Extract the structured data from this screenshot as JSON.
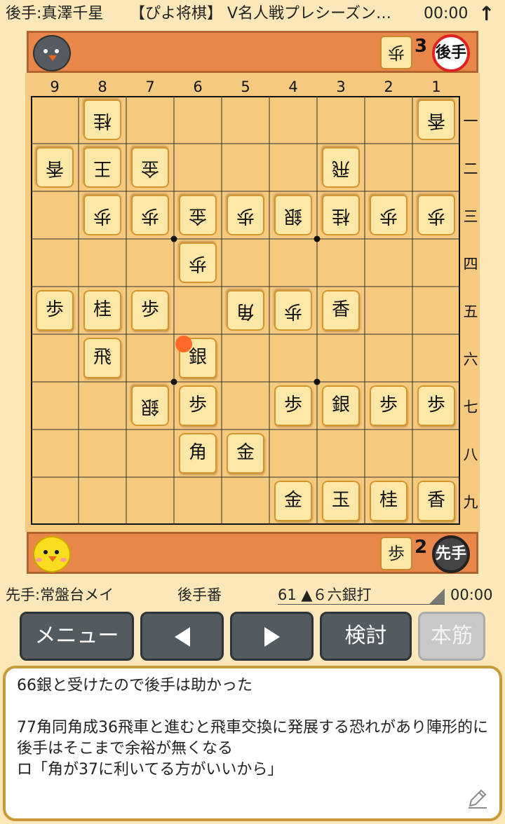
{
  "header": {
    "gote_player": "後手:真澤千星",
    "title": "【ぴよ将棋】 V名人戦プレシーズン…",
    "time": "00:00",
    "arrow": "↑"
  },
  "gote_stand": {
    "avatar": "gray-chick-icon",
    "hand_piece": "歩",
    "hand_count": "3",
    "side_label": "後手"
  },
  "sente_stand": {
    "avatar": "yellow-chick-icon",
    "hand_piece": "歩",
    "hand_count": "2",
    "side_label": "先手"
  },
  "board": {
    "files": [
      "9",
      "8",
      "7",
      "6",
      "5",
      "4",
      "3",
      "2",
      "1"
    ],
    "ranks": [
      "一",
      "二",
      "三",
      "四",
      "五",
      "六",
      "七",
      "八",
      "九"
    ],
    "pieces": [
      {
        "file": 8,
        "rank": 1,
        "char": "桂",
        "owner": "gote"
      },
      {
        "file": 1,
        "rank": 1,
        "char": "香",
        "owner": "gote"
      },
      {
        "file": 9,
        "rank": 2,
        "char": "香",
        "owner": "gote"
      },
      {
        "file": 8,
        "rank": 2,
        "char": "王",
        "owner": "gote"
      },
      {
        "file": 7,
        "rank": 2,
        "char": "金",
        "owner": "gote"
      },
      {
        "file": 3,
        "rank": 2,
        "char": "飛",
        "owner": "gote"
      },
      {
        "file": 8,
        "rank": 3,
        "char": "歩",
        "owner": "gote"
      },
      {
        "file": 7,
        "rank": 3,
        "char": "歩",
        "owner": "gote"
      },
      {
        "file": 6,
        "rank": 3,
        "char": "金",
        "owner": "gote"
      },
      {
        "file": 5,
        "rank": 3,
        "char": "歩",
        "owner": "gote"
      },
      {
        "file": 4,
        "rank": 3,
        "char": "銀",
        "owner": "gote"
      },
      {
        "file": 3,
        "rank": 3,
        "char": "桂",
        "owner": "gote"
      },
      {
        "file": 2,
        "rank": 3,
        "char": "歩",
        "owner": "gote"
      },
      {
        "file": 1,
        "rank": 3,
        "char": "歩",
        "owner": "gote"
      },
      {
        "file": 6,
        "rank": 4,
        "char": "歩",
        "owner": "gote"
      },
      {
        "file": 9,
        "rank": 5,
        "char": "歩",
        "owner": "sente"
      },
      {
        "file": 8,
        "rank": 5,
        "char": "桂",
        "owner": "sente"
      },
      {
        "file": 7,
        "rank": 5,
        "char": "歩",
        "owner": "sente"
      },
      {
        "file": 5,
        "rank": 5,
        "char": "角",
        "owner": "gote"
      },
      {
        "file": 4,
        "rank": 5,
        "char": "歩",
        "owner": "gote"
      },
      {
        "file": 3,
        "rank": 5,
        "char": "香",
        "owner": "sente"
      },
      {
        "file": 8,
        "rank": 6,
        "char": "飛",
        "owner": "sente"
      },
      {
        "file": 6,
        "rank": 6,
        "char": "銀",
        "owner": "sente"
      },
      {
        "file": 7,
        "rank": 7,
        "char": "銀",
        "owner": "gote"
      },
      {
        "file": 6,
        "rank": 7,
        "char": "歩",
        "owner": "sente"
      },
      {
        "file": 4,
        "rank": 7,
        "char": "歩",
        "owner": "sente"
      },
      {
        "file": 3,
        "rank": 7,
        "char": "銀",
        "owner": "sente"
      },
      {
        "file": 2,
        "rank": 7,
        "char": "歩",
        "owner": "sente"
      },
      {
        "file": 1,
        "rank": 7,
        "char": "歩",
        "owner": "sente"
      },
      {
        "file": 6,
        "rank": 8,
        "char": "角",
        "owner": "sente"
      },
      {
        "file": 5,
        "rank": 8,
        "char": "金",
        "owner": "sente"
      },
      {
        "file": 4,
        "rank": 9,
        "char": "金",
        "owner": "sente"
      },
      {
        "file": 3,
        "rank": 9,
        "char": "玉",
        "owner": "sente"
      },
      {
        "file": 2,
        "rank": 9,
        "char": "桂",
        "owner": "sente"
      },
      {
        "file": 1,
        "rank": 9,
        "char": "香",
        "owner": "sente"
      }
    ],
    "last_move": {
      "file": 6,
      "rank": 6
    }
  },
  "info": {
    "sente_player": "先手:常盤台メイ",
    "turn": "後手番",
    "move": "61 ▲６六銀打",
    "time": "00:00"
  },
  "buttons": {
    "menu": "メニュー",
    "prev": "back-triangle-icon",
    "next": "forward-triangle-icon",
    "review": "検討",
    "mainline": "本筋"
  },
  "comment": "66銀と受けたので後手は助かった\n\n77角同角成36飛車と進むと飛車交換に発展する恐れがあり陣形的に後手はそこまで余裕が無くなる\nロ「角が37に利いてる方がいいから」",
  "colors": {
    "background": "#fbe7b8",
    "stand": "#e9874a",
    "board": "#f5c97e",
    "piece": "#fde7a6",
    "button": "#535a60",
    "highlight": "#ff6a28"
  }
}
